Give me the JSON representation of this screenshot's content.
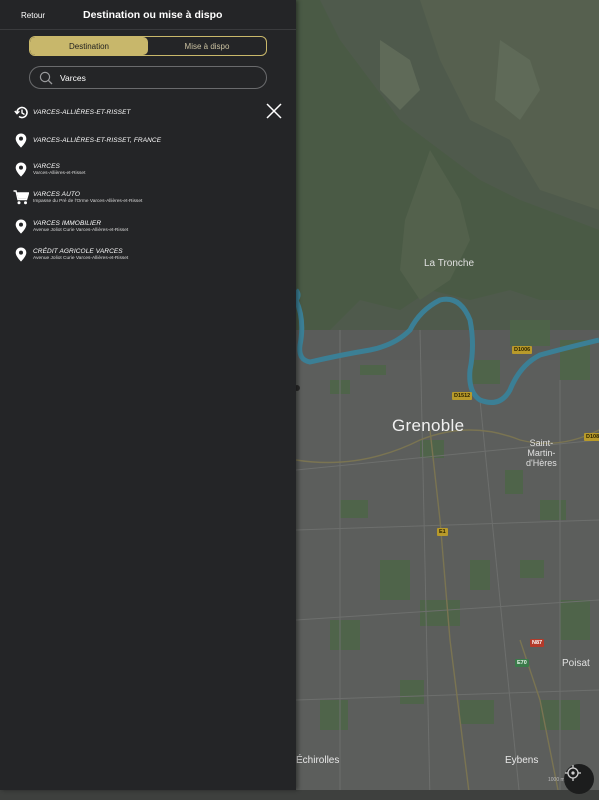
{
  "header": {
    "back_label": "Retour",
    "title": "Destination ou mise à dispo"
  },
  "segmented": {
    "active_label": "Destination",
    "inactive_label": "Mise à dispo"
  },
  "search": {
    "value": "Varces",
    "icon": "search-icon"
  },
  "results": [
    {
      "icon": "history-icon",
      "title": "VARCES-ALLIÈRES-ET-RISSET",
      "subtitle": ""
    },
    {
      "icon": "pin-icon",
      "title": "VARCES-ALLIÈRES-ET-RISSET, FRANCE",
      "subtitle": ""
    },
    {
      "icon": "pin-icon",
      "title": "VARCES",
      "subtitle": "Varces-Allières-et-Risset"
    },
    {
      "icon": "cart-icon",
      "title": "VARCES AUTO",
      "subtitle": "Impasse du Pré de l'Orme Varces-Allières-et-Risset"
    },
    {
      "icon": "pin-icon",
      "title": "VARCES IMMOBILIER",
      "subtitle": "Avenue Joliot Curie Varces-Allières-et-Risset"
    },
    {
      "icon": "pin-icon",
      "title": "CRÉDIT AGRICOLE VARCES",
      "subtitle": "Avenue Joliot Curie Varces-Allières-et-Risset"
    }
  ],
  "map": {
    "labels": {
      "tronche": "La Tronche",
      "grenoble": "Grenoble",
      "stmartin": "Saint-\nMartin-\nd'Hères",
      "poisat": "Poisat",
      "echirolles": "Échirolles",
      "eybens": "Eybens"
    },
    "badges": {
      "d1006": "D1006",
      "d1512": "D1512",
      "d1087": "D108",
      "e1": "E1",
      "n87": "N87",
      "e70": "E70",
      "scale": "1000 m"
    }
  },
  "colors": {
    "accent": "#c8b76b",
    "panel": "#242527",
    "map_bg": "#5a5c5a",
    "river": "#3b7f95"
  }
}
